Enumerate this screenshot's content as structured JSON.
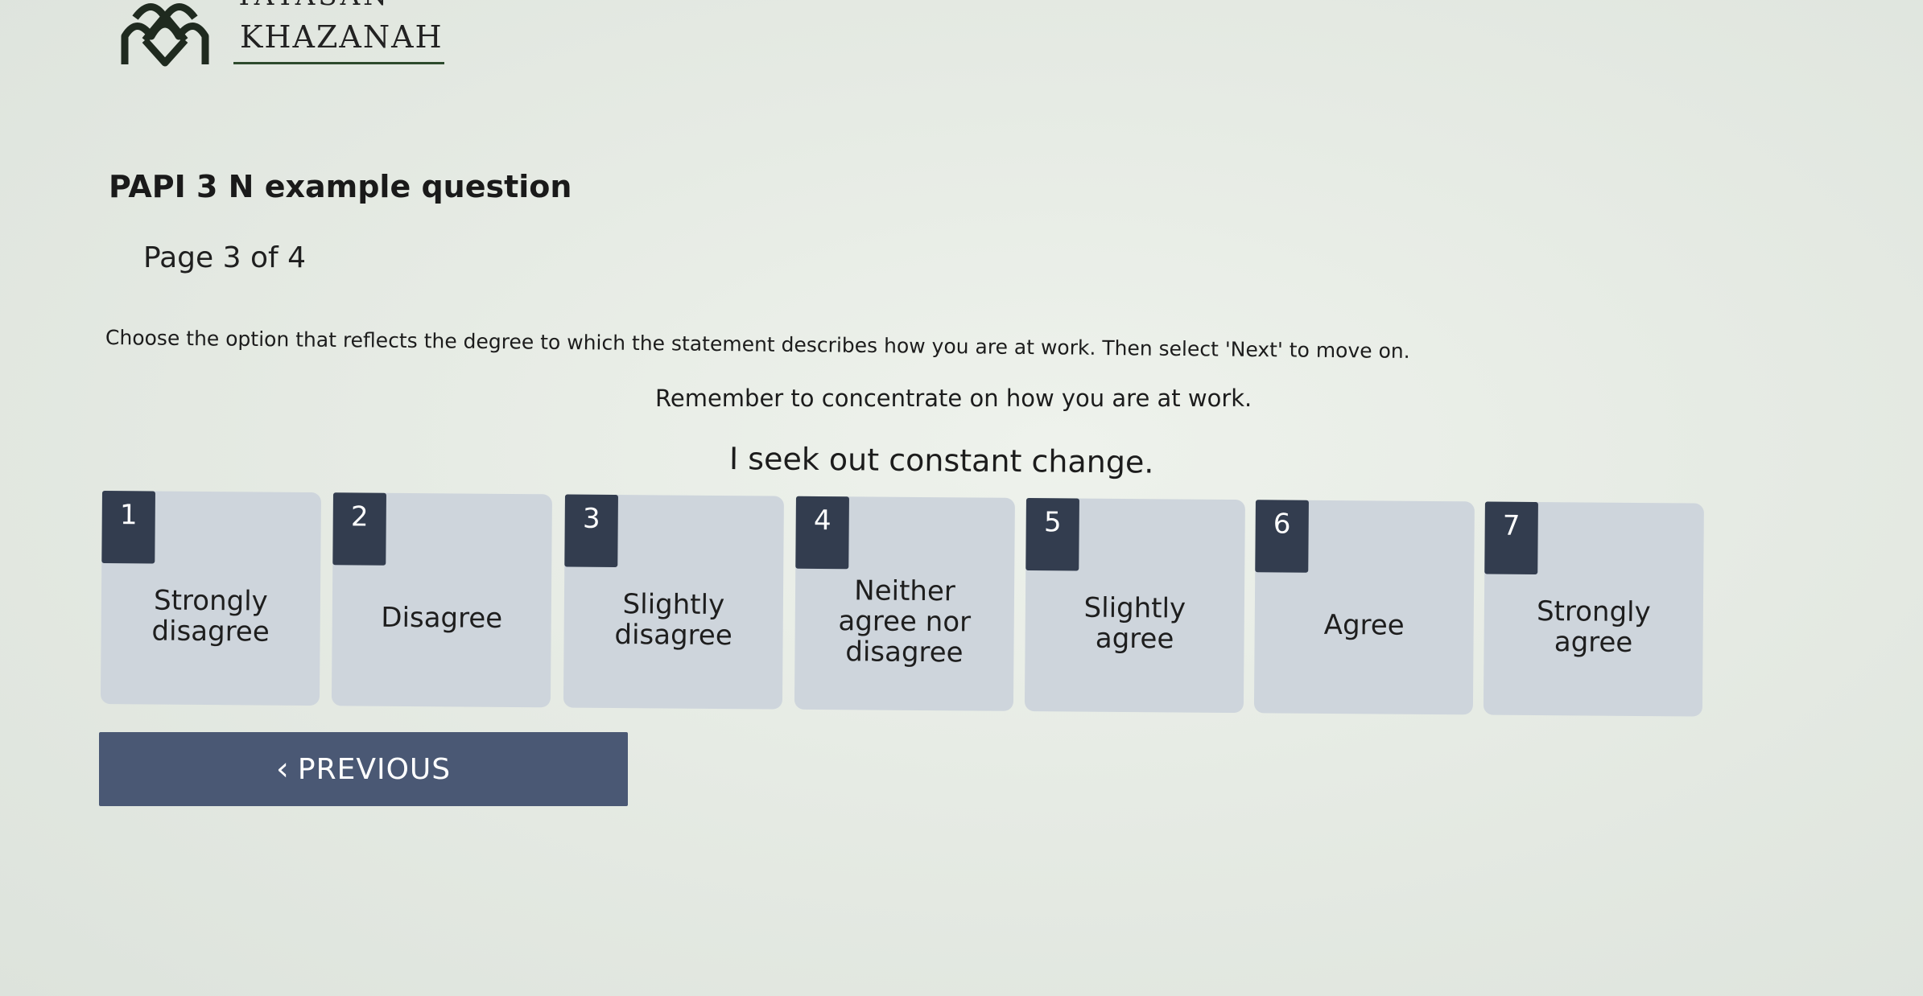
{
  "logo": {
    "line1": "YAYASAN",
    "line2": "KHAZANAH"
  },
  "page": {
    "title": "PAPI 3 N example question",
    "page_indicator": "Page 3 of 4",
    "instructions": "Choose the option that reflects the degree to which the statement describes how you are at work. Then select 'Next' to move on.",
    "reminder": "Remember to concentrate on how you are at work.",
    "statement": "I seek out constant change."
  },
  "options": [
    {
      "number": "1",
      "label": "Strongly disagree"
    },
    {
      "number": "2",
      "label": "Disagree"
    },
    {
      "number": "3",
      "label": "Slightly disagree"
    },
    {
      "number": "4",
      "label": "Neither agree nor disagree"
    },
    {
      "number": "5",
      "label": "Slightly agree"
    },
    {
      "number": "6",
      "label": "Agree"
    },
    {
      "number": "7",
      "label": "Strongly agree"
    }
  ],
  "navigation": {
    "previous_label": "PREVIOUS",
    "previous_icon": "chevron-left-icon"
  },
  "colors": {
    "number_badge": "#333d4f",
    "option_background": "#ced5dc",
    "button_background": "#4a5874",
    "logo_green": "#2d4a2c"
  }
}
